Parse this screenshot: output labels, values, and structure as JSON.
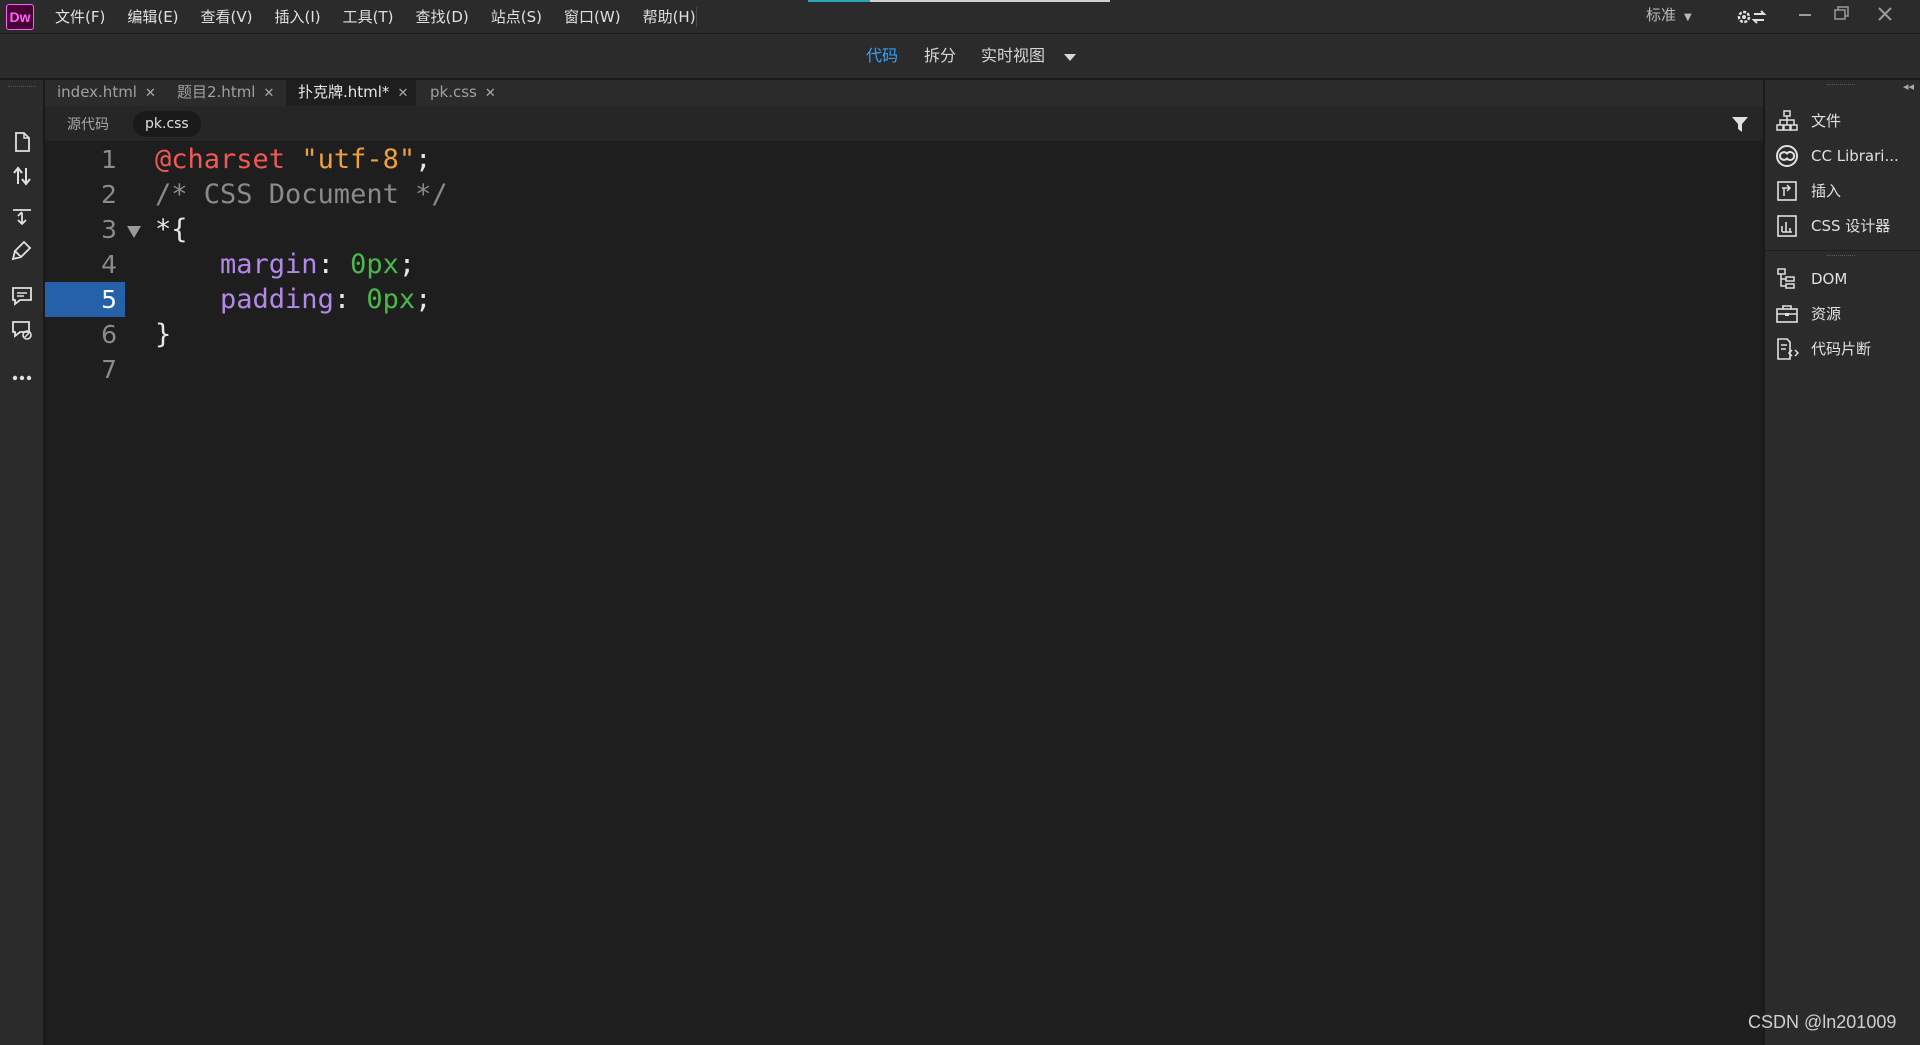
{
  "app": {
    "logo_text": "Dw",
    "brand_color": "#ff61f6",
    "accent_color": "#35a0f5"
  },
  "menu": [
    "文件(F)",
    "编辑(E)",
    "查看(V)",
    "插入(I)",
    "工具(T)",
    "查找(D)",
    "站点(S)",
    "窗口(W)",
    "帮助(H)"
  ],
  "workspace": {
    "label": "标准"
  },
  "view_modes": {
    "code": "代码",
    "split": "拆分",
    "live": "实时视图",
    "active": "code"
  },
  "tabs": [
    {
      "label": "index.html",
      "active": false
    },
    {
      "label": "题目2.html",
      "active": false
    },
    {
      "label": "扑克牌.html*",
      "active": true
    },
    {
      "label": "pk.css",
      "active": false
    }
  ],
  "related_files": {
    "source": "源代码",
    "file": "pk.css"
  },
  "editor": {
    "current_line": 5,
    "line_numbers": [
      "1",
      "2",
      "3",
      "4",
      "5",
      "6",
      "7"
    ],
    "lines": [
      [
        {
          "t": "@charset",
          "c": "at"
        },
        {
          "t": " ",
          "c": "punc"
        },
        {
          "t": "\"utf-8\"",
          "c": "str"
        },
        {
          "t": ";",
          "c": "punc"
        }
      ],
      [
        {
          "t": "/* CSS Document */",
          "c": "comment"
        }
      ],
      [
        {
          "t": "*{",
          "c": "punc"
        }
      ],
      [
        {
          "t": "    ",
          "c": "punc"
        },
        {
          "t": "margin",
          "c": "prop"
        },
        {
          "t": ": ",
          "c": "punc"
        },
        {
          "t": "0px",
          "c": "num"
        },
        {
          "t": ";",
          "c": "punc"
        }
      ],
      [
        {
          "t": "    ",
          "c": "punc"
        },
        {
          "t": "padding",
          "c": "prop"
        },
        {
          "t": ": ",
          "c": "punc"
        },
        {
          "t": "0px",
          "c": "num"
        },
        {
          "t": ";",
          "c": "punc"
        }
      ],
      [
        {
          "t": "}",
          "c": "punc"
        }
      ],
      []
    ]
  },
  "right_panel": {
    "items": [
      {
        "label": "文件",
        "icon": "files-icon"
      },
      {
        "label": "CC Librari...",
        "icon": "cc-libraries-icon"
      },
      {
        "label": "插入",
        "icon": "insert-icon"
      },
      {
        "label": "CSS 设计器",
        "icon": "css-designer-icon"
      },
      {
        "label": "DOM",
        "icon": "dom-icon"
      },
      {
        "label": "资源",
        "icon": "assets-icon"
      },
      {
        "label": "代码片断",
        "icon": "snippets-icon"
      }
    ]
  },
  "left_toolbar": [
    "open-document-icon",
    "file-transfer-icon",
    "expand-collapse-icon",
    "format-source-icon",
    "comment-icon",
    "remove-comment-icon",
    "more-tools-icon"
  ],
  "watermark": "CSDN @ln201009"
}
